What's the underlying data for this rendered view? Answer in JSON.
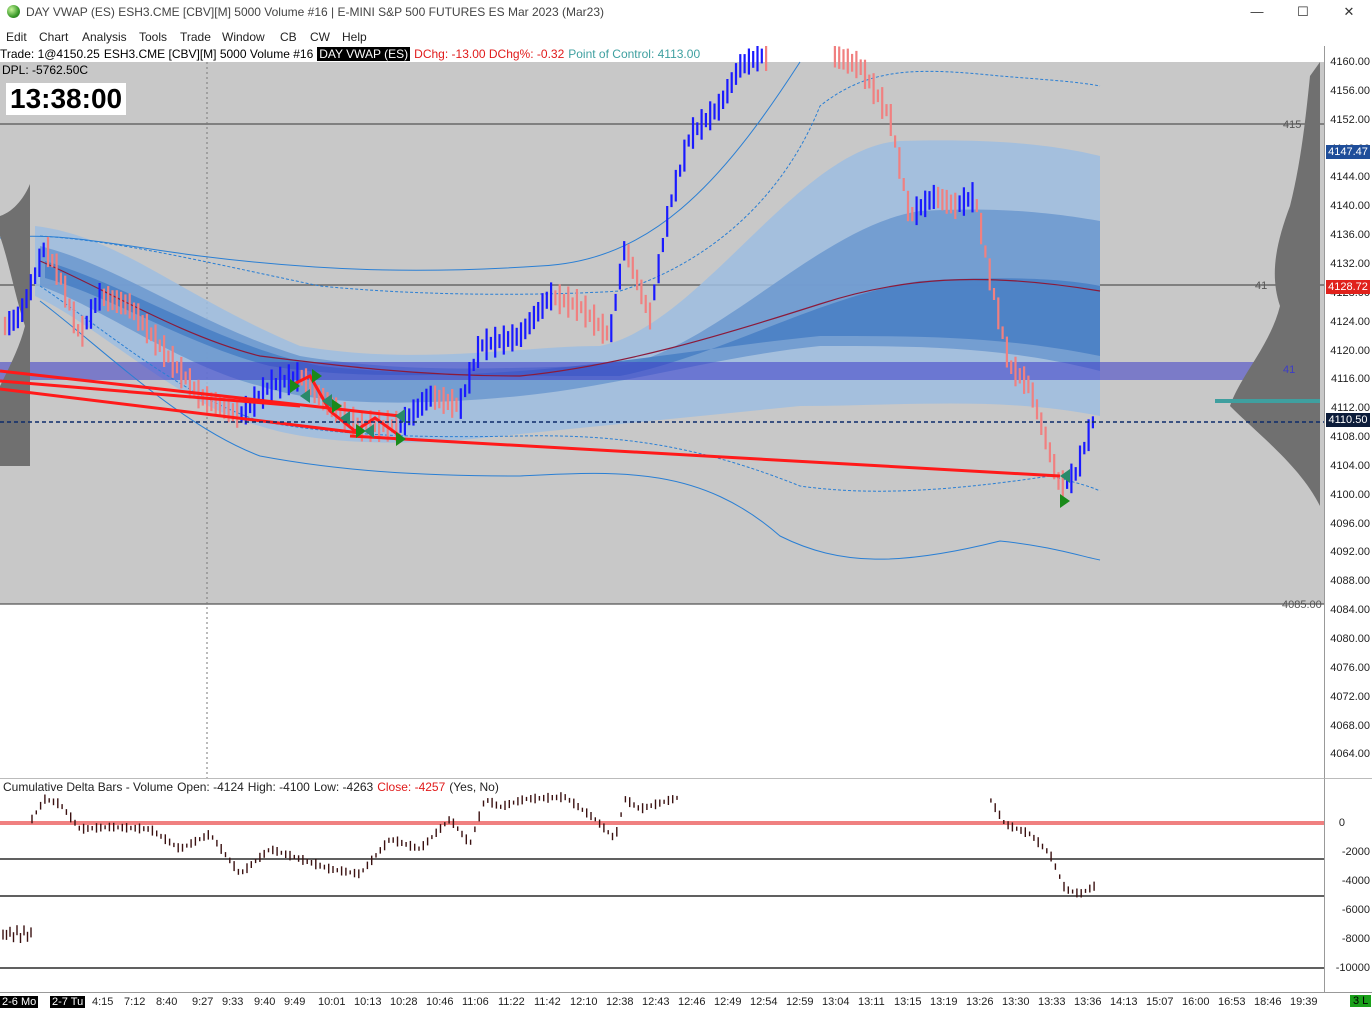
{
  "window": {
    "title": "DAY VWAP (ES) ESH3.CME [CBV][M]  5000 Volume  #16 | E-MINI S&P 500 FUTURES ES Mar 2023 (Mar23)",
    "minimize": "—",
    "maximize": "☐",
    "close": "✕"
  },
  "menu": [
    "Edit",
    "Chart",
    "Analysis",
    "Tools",
    "Trade",
    "Window",
    "CB",
    "CW",
    "Help"
  ],
  "info": {
    "trade": "Trade: 1@4150.25",
    "symbol": "ESH3.CME [CBV][M]  5000 Volume  #16",
    "study": "DAY VWAP (ES)",
    "dchg": "DChg: -13.00 DChg%: -0.32",
    "poc": "Point of Control: 4113.00",
    "dpl": "DPL: -5762.50C"
  },
  "clock": "13:38:00",
  "price_axis": {
    "ticks": [
      "4160.00",
      "4156.00",
      "4152.00",
      "4148.00",
      "4144.00",
      "4140.00",
      "4136.00",
      "4132.00",
      "4128.00",
      "4124.00",
      "4120.00",
      "4116.00",
      "4112.00",
      "4108.00",
      "4104.00",
      "4100.00",
      "4096.00",
      "4092.00",
      "4088.00",
      "4084.00",
      "4080.00",
      "4076.00",
      "4072.00",
      "4068.00",
      "4064.00"
    ],
    "labels": [
      {
        "text": "4147.47",
        "color": "#1f4e9a"
      },
      {
        "text": "4128.72",
        "color": "#e0221c"
      },
      {
        "text": "4110.50",
        "color": "#0c1c3a"
      }
    ],
    "line_labels": [
      "415",
      "41",
      "41",
      "4085.00"
    ]
  },
  "delta_legend": {
    "name": "Cumulative Delta Bars - Volume",
    "open": "Open: -4124",
    "high": "High: -4100",
    "low": "Low: -4263",
    "close": "Close: -4257",
    "flags": "(Yes, No)"
  },
  "delta_axis": {
    "ticks": [
      "0",
      "-2000",
      "-4000",
      "-6000",
      "-8000",
      "-10000"
    ]
  },
  "time_axis": {
    "dates": [
      "2-6 Mo",
      "2-7 Tu"
    ],
    "times": [
      "4:15",
      "7:12",
      "8:40",
      "9:27",
      "9:33",
      "9:40",
      "9:49",
      "10:01",
      "10:13",
      "10:28",
      "10:46",
      "11:06",
      "11:22",
      "11:42",
      "12:10",
      "12:38",
      "12:43",
      "12:46",
      "12:49",
      "12:54",
      "12:59",
      "13:04",
      "13:11",
      "13:15",
      "13:19",
      "13:26",
      "13:30",
      "13:33",
      "13:36",
      "14:13",
      "15:07",
      "16:00",
      "16:53",
      "18:46",
      "19:39"
    ],
    "right_badge": "3 L"
  },
  "colors": {
    "up_bar": "#1a1aff",
    "down_bar": "#f08080",
    "trend_line": "#ff1a1a",
    "vwap": "#8b1a3a",
    "band_fill": "#4a7fc4",
    "value_area": "#c8c8c8",
    "poc_band": "#3c3cc8",
    "profile": "#707070"
  }
}
